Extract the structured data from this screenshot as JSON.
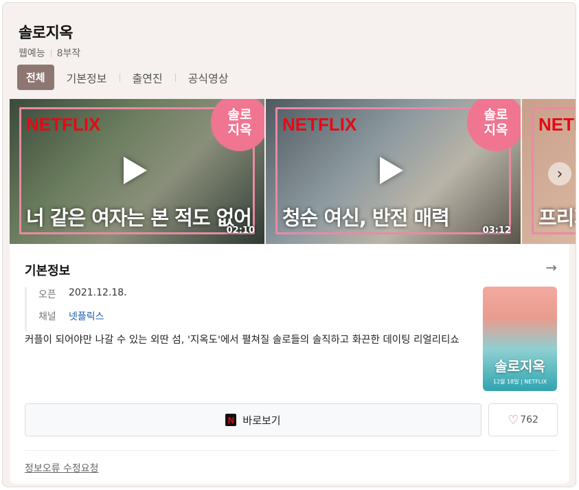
{
  "header": {
    "title": "솔로지옥",
    "genre": "웹예능",
    "episodes": "8부작"
  },
  "tabs": [
    "전체",
    "기본정보",
    "출연진",
    "공식영상"
  ],
  "videos": [
    {
      "brand": "NETFLIX",
      "badge": "솔로\n지옥",
      "caption": "너 같은 여자는 본 적도 없어",
      "duration": "02:10"
    },
    {
      "brand": "NETFLIX",
      "badge": "솔로\n지옥",
      "caption": "청순 여신, 반전 매력",
      "duration": "03:12"
    },
    {
      "brand": "NETFLIX",
      "badge": "",
      "caption": "프리지",
      "duration": ""
    }
  ],
  "info": {
    "section_title": "기본정보",
    "open_label": "오픈",
    "open_value": "2021.12.18.",
    "channel_label": "채널",
    "channel_value": "넷플릭스",
    "description": "커플이 되어야만 나갈 수 있는 외딴 섬, '지옥도'에서 펼쳐질 솔로들의 솔직하고 화끈한 데이팅 리얼리티쇼",
    "poster_title": "솔로지옥",
    "poster_date": "12월 18일 | NETFLIX",
    "watch_label": "바로보기",
    "watch_icon_letter": "N",
    "like_count": "762",
    "report_label": "정보오류 수정요청"
  },
  "colors": {
    "active_tab": "#8e7772",
    "netflix_red": "#e50914",
    "frame_pink": "#e98aa3",
    "link_blue": "#1a5fb4"
  },
  "icons": [
    "play-icon",
    "chevron-right-icon",
    "arrow-right-icon",
    "netflix-icon",
    "heart-icon"
  ]
}
